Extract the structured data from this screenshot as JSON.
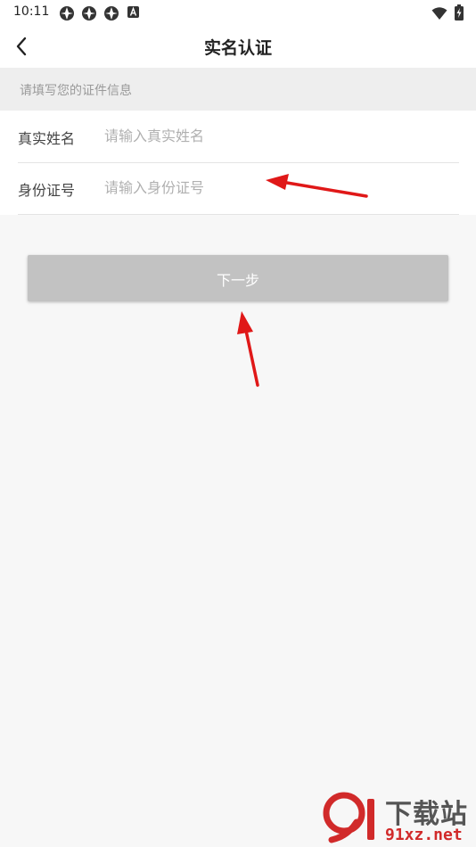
{
  "status_bar": {
    "time": "10:11",
    "notification_icons": [
      "app-notification-icon",
      "app-notification-icon",
      "app-notification-icon",
      "keyboard-a-icon"
    ],
    "right_icons": [
      "wifi-icon",
      "battery-charging-icon"
    ]
  },
  "header": {
    "title": "实名认证",
    "back_icon": "chevron-left-icon"
  },
  "section": {
    "hint": "请填写您的证件信息"
  },
  "form": {
    "fields": [
      {
        "label": "真实姓名",
        "placeholder": "请输入真实姓名",
        "value": ""
      },
      {
        "label": "身份证号",
        "placeholder": "请输入身份证号",
        "value": ""
      }
    ]
  },
  "actions": {
    "next_label": "下一步"
  },
  "watermark": {
    "brand": "下载站",
    "site": "91xz.net"
  },
  "colors": {
    "background": "#f7f7f7",
    "button_disabled": "#c2c2c2",
    "annotation_arrow": "#e01818",
    "watermark_red": "#d12a2a"
  }
}
